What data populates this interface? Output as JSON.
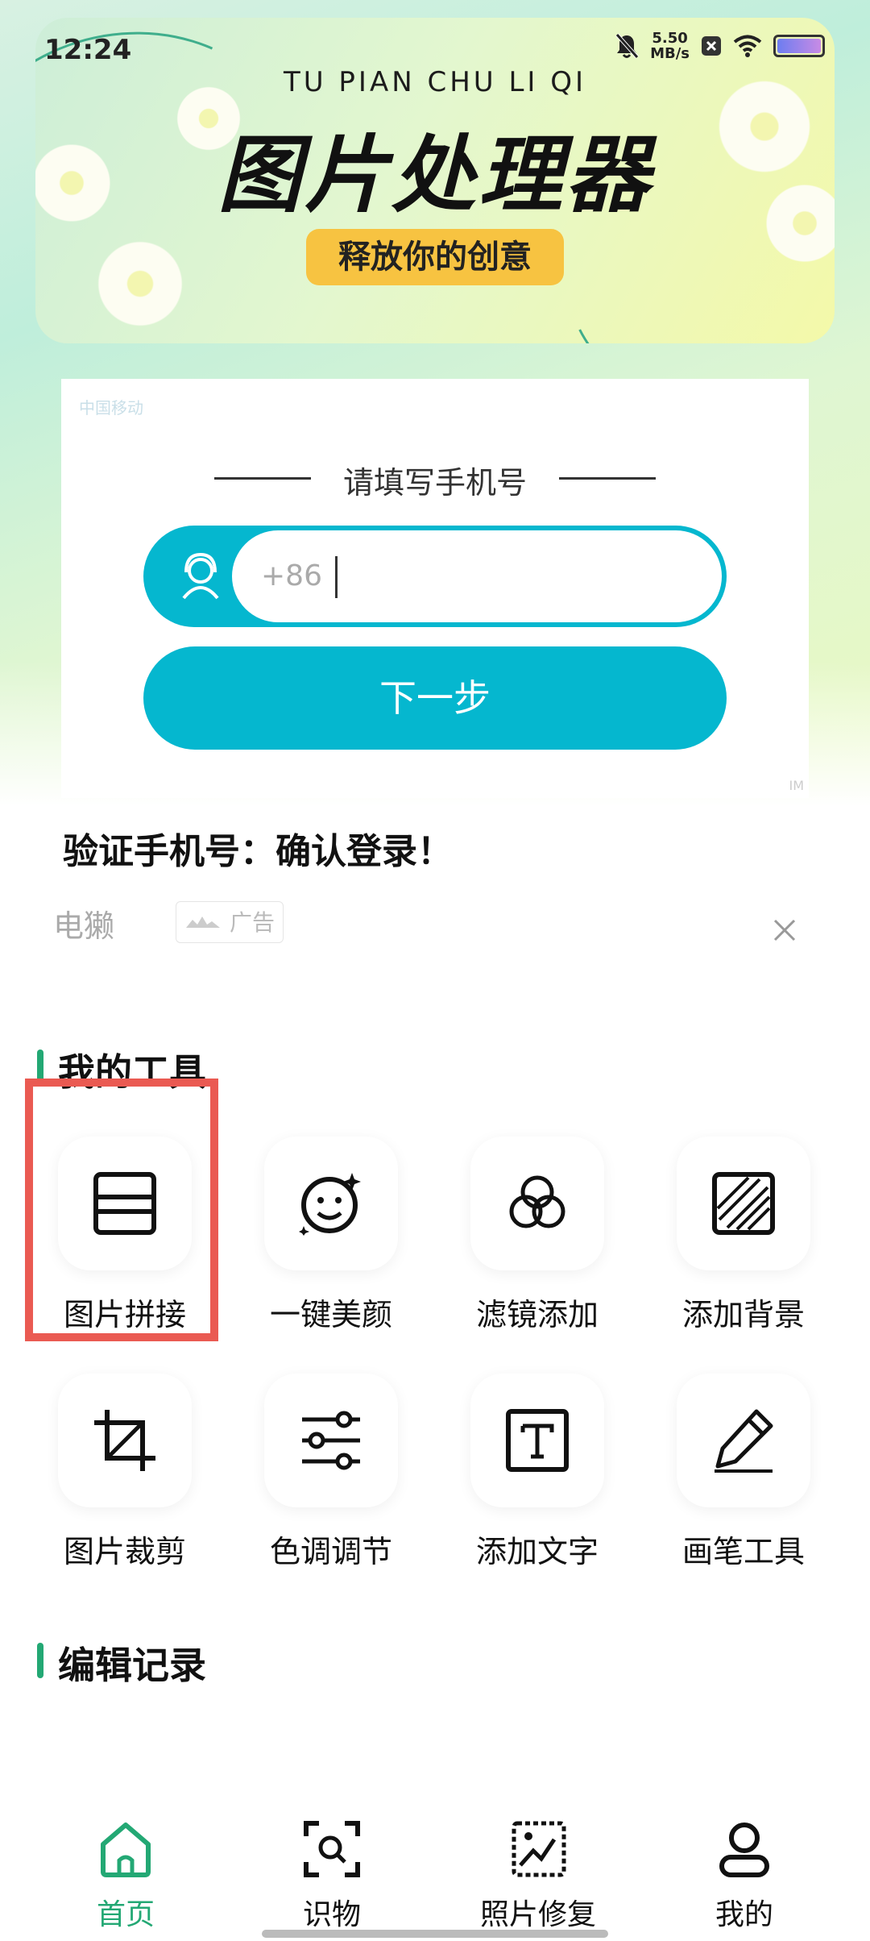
{
  "status_bar": {
    "time": "12:24",
    "speed_value": "5.50",
    "speed_unit": "MB/s"
  },
  "banner": {
    "pinyin": "TU PIAN CHU LI QI",
    "title": "图片处理器",
    "slogan": "释放你的创意"
  },
  "ad": {
    "logo_text": "中国移动",
    "prompt": "请填写手机号",
    "phone_prefix": "+86",
    "next_button": "下一步",
    "corner_mark": "IM",
    "headline": "验证手机号：确认登录！",
    "brand": "电獭",
    "tag": "广告"
  },
  "sections": {
    "my_tools": "我的工具",
    "edit_history": "编辑记录"
  },
  "tools": [
    {
      "label": "图片拼接",
      "icon": "collage-icon"
    },
    {
      "label": "一键美颜",
      "icon": "beauty-face-icon"
    },
    {
      "label": "滤镜添加",
      "icon": "filter-icon"
    },
    {
      "label": "添加背景",
      "icon": "background-icon"
    },
    {
      "label": "图片裁剪",
      "icon": "crop-icon"
    },
    {
      "label": "色调调节",
      "icon": "tone-sliders-icon"
    },
    {
      "label": "添加文字",
      "icon": "text-icon"
    },
    {
      "label": "画笔工具",
      "icon": "brush-icon"
    }
  ],
  "nav": [
    {
      "label": "首页",
      "icon": "home-icon",
      "active": true
    },
    {
      "label": "识物",
      "icon": "scan-icon"
    },
    {
      "label": "照片修复",
      "icon": "photo-repair-icon"
    },
    {
      "label": "我的",
      "icon": "profile-icon"
    }
  ],
  "colors": {
    "accent": "#23a874",
    "ad_button": "#05b7cf",
    "highlight": "#ea5a52",
    "slogan_bg": "#f7c341"
  }
}
